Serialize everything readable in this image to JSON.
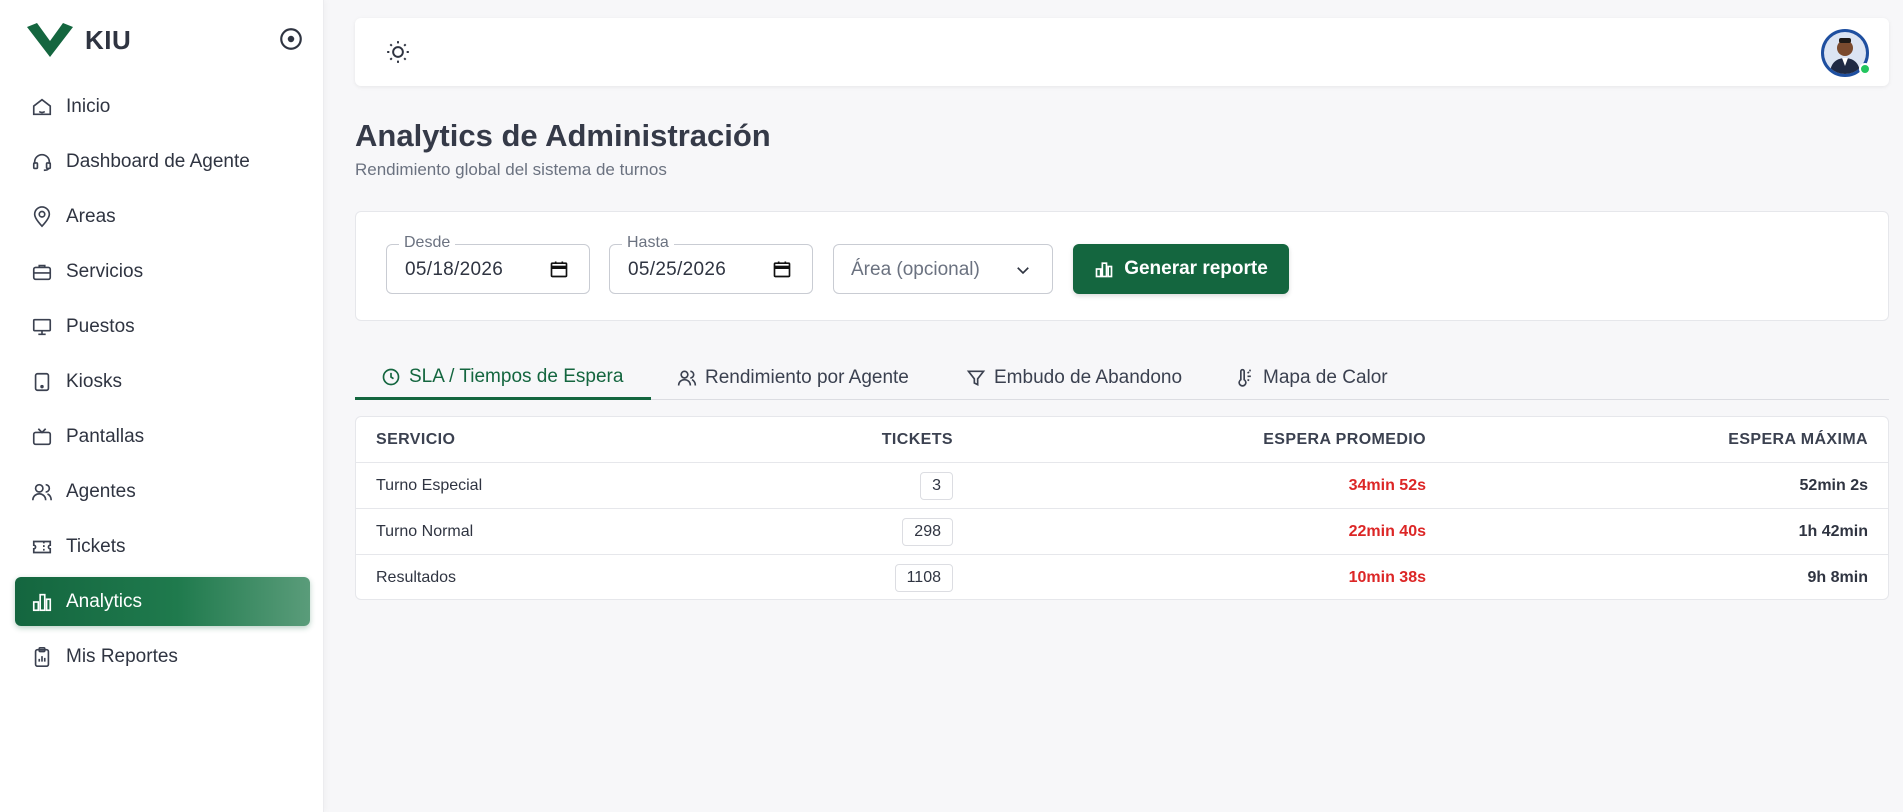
{
  "brand": {
    "name": "KIU"
  },
  "sidebar": {
    "items": [
      {
        "label": "Inicio",
        "icon": "home-icon"
      },
      {
        "label": "Dashboard de Agente",
        "icon": "headset-icon"
      },
      {
        "label": "Areas",
        "icon": "map-pin-icon"
      },
      {
        "label": "Servicios",
        "icon": "briefcase-icon"
      },
      {
        "label": "Puestos",
        "icon": "monitor-icon"
      },
      {
        "label": "Kiosks",
        "icon": "tablet-icon"
      },
      {
        "label": "Pantallas",
        "icon": "tv-icon"
      },
      {
        "label": "Agentes",
        "icon": "users-icon"
      },
      {
        "label": "Tickets",
        "icon": "ticket-icon"
      },
      {
        "label": "Analytics",
        "icon": "bar-chart-icon",
        "active": true
      },
      {
        "label": "Mis Reportes",
        "icon": "clipboard-icon"
      }
    ]
  },
  "header": {
    "title": "Analytics de Administración",
    "subtitle": "Rendimiento global del sistema de turnos"
  },
  "filters": {
    "desde_label": "Desde",
    "desde_value": "05/18/2026",
    "hasta_label": "Hasta",
    "hasta_value": "05/25/2026",
    "area_placeholder": "Área (opcional)",
    "generate_label": "Generar reporte"
  },
  "tabs": [
    {
      "label": "SLA / Tiempos de Espera",
      "active": true
    },
    {
      "label": "Rendimiento por Agente"
    },
    {
      "label": "Embudo de Abandono"
    },
    {
      "label": "Mapa de Calor"
    }
  ],
  "table": {
    "headers": [
      "SERVICIO",
      "TICKETS",
      "ESPERA PROMEDIO",
      "ESPERA MÁXIMA"
    ],
    "rows": [
      {
        "servicio": "Turno Especial",
        "tickets": "3",
        "promedio": "34min 52s",
        "maxima": "52min 2s"
      },
      {
        "servicio": "Turno Normal",
        "tickets": "298",
        "promedio": "22min 40s",
        "maxima": "1h 42min"
      },
      {
        "servicio": "Resultados",
        "tickets": "1108",
        "promedio": "10min 38s",
        "maxima": "9h 8min"
      }
    ]
  },
  "colors": {
    "accent": "#14663f",
    "danger": "#dc2626",
    "online": "#22c55e"
  }
}
